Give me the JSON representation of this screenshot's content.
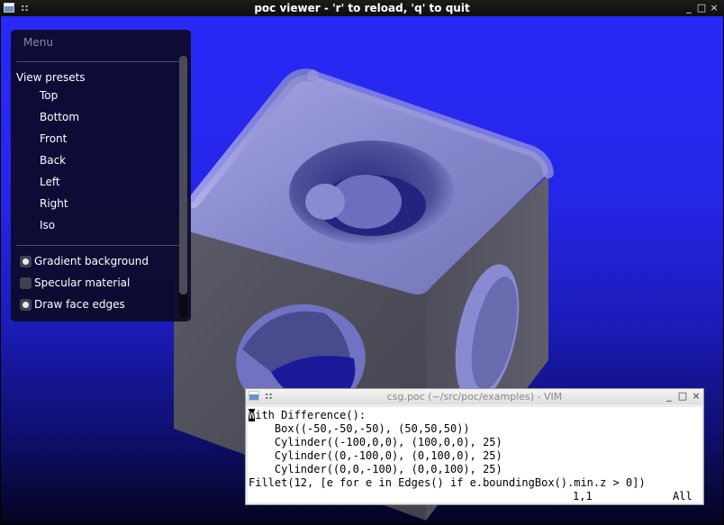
{
  "main_window": {
    "title": "poc viewer - 'r' to reload, 'q' to quit",
    "controls": {
      "minimize": "_",
      "maximize": "□",
      "close": "×"
    }
  },
  "menu": {
    "header": "Menu",
    "presets_label": "View presets",
    "presets": [
      "Top",
      "Bottom",
      "Front",
      "Back",
      "Left",
      "Right",
      "Iso"
    ],
    "options": [
      {
        "label": "Gradient background",
        "checked": true
      },
      {
        "label": "Specular material",
        "checked": false
      },
      {
        "label": "Draw face edges",
        "checked": true
      }
    ]
  },
  "vim_window": {
    "title": "csg.poc (~/src/poc/examples) - VIM",
    "controls": {
      "minimize": "_",
      "maximize": "□",
      "close": "×"
    },
    "lines": [
      "With Difference():",
      "    Box((-50,-50,-50), (50,50,50))",
      "    Cylinder((-100,0,0), (100,0,0), 25)",
      "    Cylinder((0,-100,0), (0,100,0), 25)",
      "    Cylinder((0,0,-100), (0,0,100), 25)",
      "Fillet(12, [e for e in Edges() if e.boundingBox().min.z > 0])"
    ],
    "cursor_char": "W",
    "position": "1,1",
    "scroll": "All"
  },
  "colors": {
    "viewport_top": "#2929f8",
    "viewport_bottom": "#040420",
    "cube_top": "#8c8cd2",
    "cube_front": "#4d4d59",
    "cube_right": "#5a5a66"
  }
}
